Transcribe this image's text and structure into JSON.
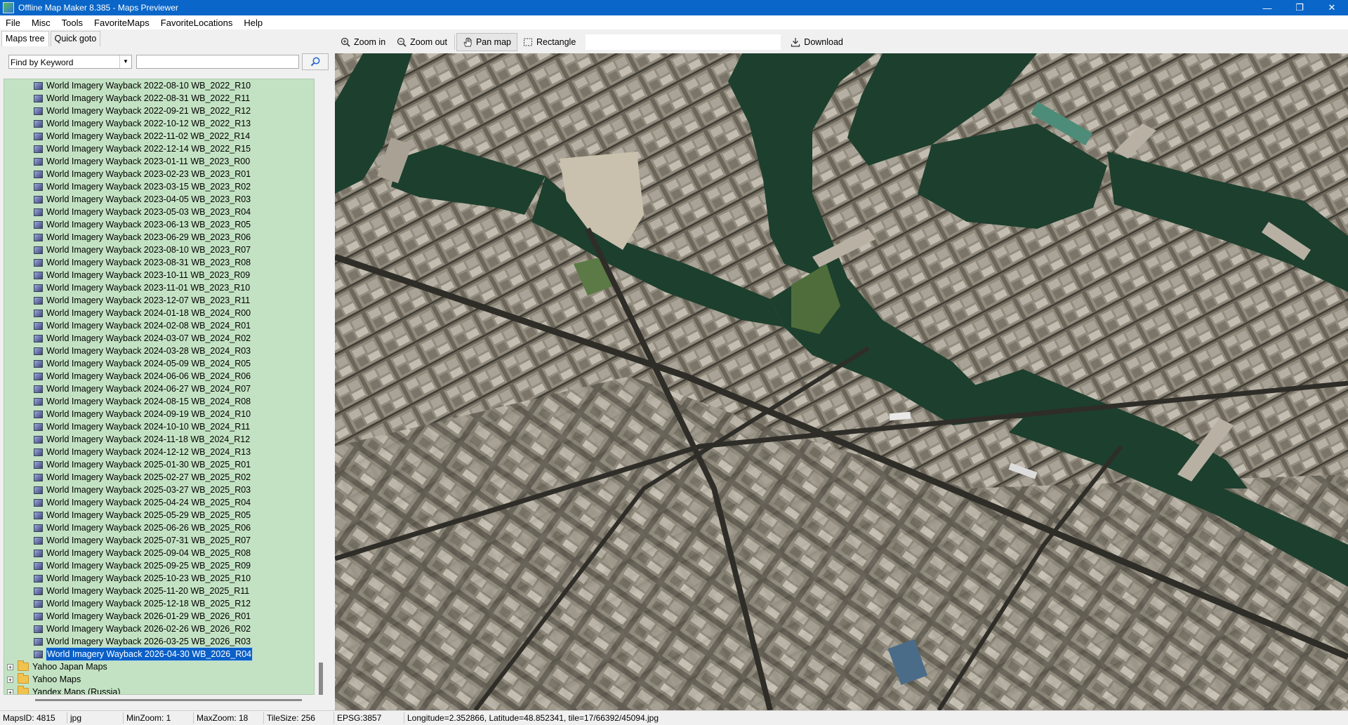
{
  "window": {
    "title": "Offline Map Maker 8.385 - Maps Previewer"
  },
  "menu": [
    "File",
    "Misc",
    "Tools",
    "FavoriteMaps",
    "FavoriteLocations",
    "Help"
  ],
  "left_tabs": [
    "Maps tree",
    "Quick goto"
  ],
  "find": {
    "mode": "Find by Keyword",
    "query": ""
  },
  "tree": {
    "maps": [
      "World Imagery Wayback 2022-08-10 WB_2022_R10",
      "World Imagery Wayback 2022-08-31 WB_2022_R11",
      "World Imagery Wayback 2022-09-21 WB_2022_R12",
      "World Imagery Wayback 2022-10-12 WB_2022_R13",
      "World Imagery Wayback 2022-11-02 WB_2022_R14",
      "World Imagery Wayback 2022-12-14 WB_2022_R15",
      "World Imagery Wayback 2023-01-11 WB_2023_R00",
      "World Imagery Wayback 2023-02-23 WB_2023_R01",
      "World Imagery Wayback 2023-03-15 WB_2023_R02",
      "World Imagery Wayback 2023-04-05 WB_2023_R03",
      "World Imagery Wayback 2023-05-03 WB_2023_R04",
      "World Imagery Wayback 2023-06-13 WB_2023_R05",
      "World Imagery Wayback 2023-06-29 WB_2023_R06",
      "World Imagery Wayback 2023-08-10 WB_2023_R07",
      "World Imagery Wayback 2023-08-31 WB_2023_R08",
      "World Imagery Wayback 2023-10-11 WB_2023_R09",
      "World Imagery Wayback 2023-11-01 WB_2023_R10",
      "World Imagery Wayback 2023-12-07 WB_2023_R11",
      "World Imagery Wayback 2024-01-18 WB_2024_R00",
      "World Imagery Wayback 2024-02-08 WB_2024_R01",
      "World Imagery Wayback 2024-03-07 WB_2024_R02",
      "World Imagery Wayback 2024-03-28 WB_2024_R03",
      "World Imagery Wayback 2024-05-09 WB_2024_R05",
      "World Imagery Wayback 2024-06-06 WB_2024_R06",
      "World Imagery Wayback 2024-06-27 WB_2024_R07",
      "World Imagery Wayback 2024-08-15 WB_2024_R08",
      "World Imagery Wayback 2024-09-19 WB_2024_R10",
      "World Imagery Wayback 2024-10-10 WB_2024_R11",
      "World Imagery Wayback 2024-11-18 WB_2024_R12",
      "World Imagery Wayback 2024-12-12 WB_2024_R13",
      "World Imagery Wayback 2025-01-30 WB_2025_R01",
      "World Imagery Wayback 2025-02-27 WB_2025_R02",
      "World Imagery Wayback 2025-03-27 WB_2025_R03",
      "World Imagery Wayback 2025-04-24 WB_2025_R04",
      "World Imagery Wayback 2025-05-29 WB_2025_R05",
      "World Imagery Wayback 2025-06-26 WB_2025_R06",
      "World Imagery Wayback 2025-07-31 WB_2025_R07",
      "World Imagery Wayback 2025-09-04 WB_2025_R08",
      "World Imagery Wayback 2025-09-25 WB_2025_R09",
      "World Imagery Wayback 2025-10-23 WB_2025_R10",
      "World Imagery Wayback 2025-11-20 WB_2025_R11",
      "World Imagery Wayback 2025-12-18 WB_2025_R12",
      "World Imagery Wayback 2026-01-29 WB_2026_R01",
      "World Imagery Wayback 2026-02-26 WB_2026_R02",
      "World Imagery Wayback 2026-03-25 WB_2026_R03",
      "World Imagery Wayback 2026-04-30 WB_2026_R04"
    ],
    "selected_index": 45,
    "folders": [
      "Yahoo Japan Maps",
      "Yahoo Maps",
      "Yandex Maps (Russia)"
    ]
  },
  "toolbar": {
    "zoom_in": "Zoom in",
    "zoom_out": "Zoom out",
    "pan_map": "Pan map",
    "rectangle": "Rectangle",
    "download": "Download"
  },
  "status": {
    "maps_id": "MapsID: 4815",
    "format": "jpg",
    "min_zoom": "MinZoom: 1",
    "max_zoom": "MaxZoom: 18",
    "tile_size": "TileSize: 256",
    "epsg": "EPSG:3857",
    "position": "Longitude=2.352866, Latitude=48.852341, tile=17/66392/45094.jpg"
  },
  "colors": {
    "titlebar": "#0a66c8",
    "tree_bg": "#c3e2c3",
    "selection": "#0a5fc8",
    "river": "#1d3f2e"
  }
}
